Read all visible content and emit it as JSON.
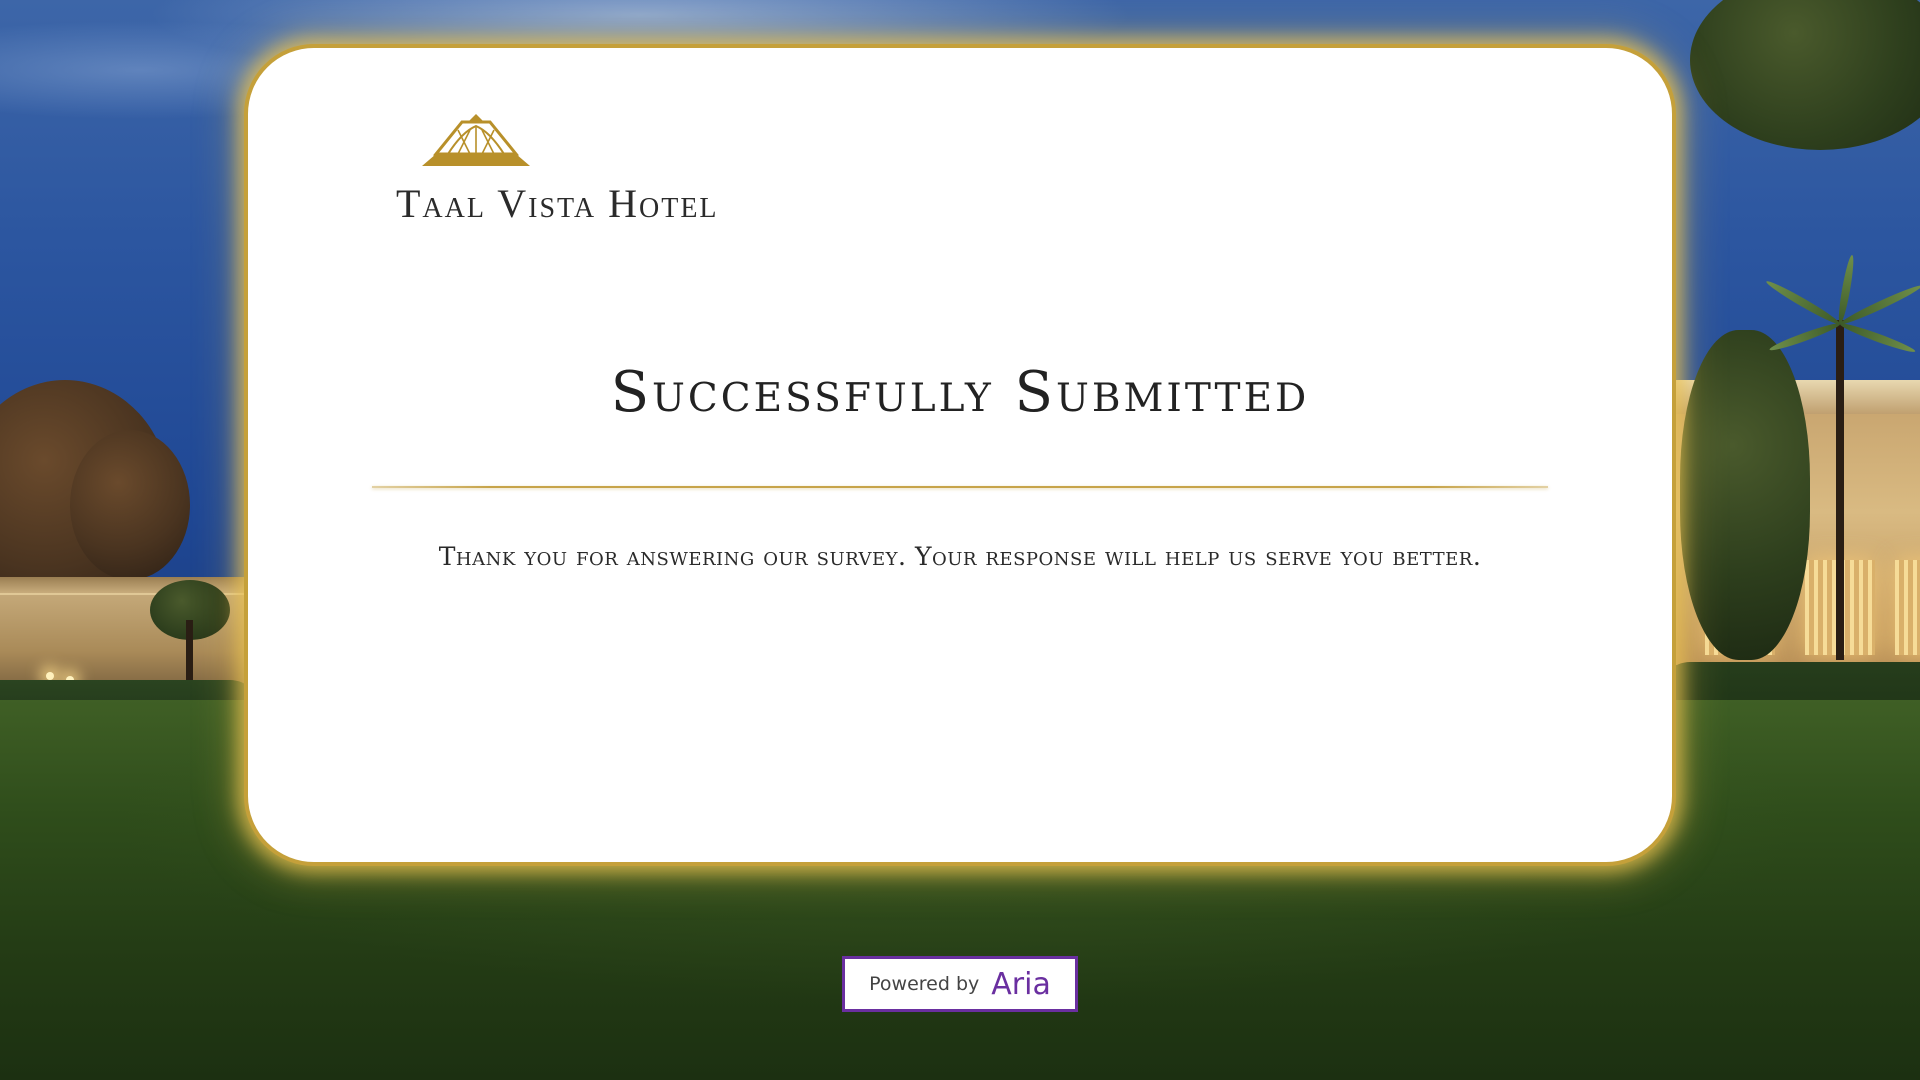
{
  "brand": {
    "name": "Taal Vista Hotel",
    "logo_icon": "hotel-roof-logo-icon",
    "accent_color": "#c5a03a"
  },
  "confirmation": {
    "title": "Successfully Submitted",
    "message": "Thank you for answering our survey. Your response will help us serve you better."
  },
  "footer": {
    "powered_by_label": "Powered by",
    "powered_by_brand": "Aria",
    "brand_color": "#6a2fa0"
  }
}
